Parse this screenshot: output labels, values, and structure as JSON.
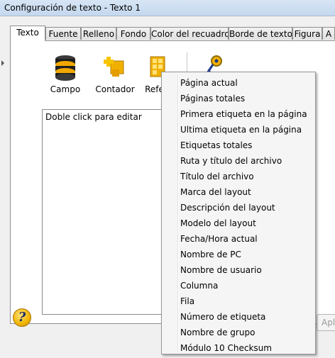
{
  "window": {
    "title": "Configuración de texto - Texto 1"
  },
  "tabs": [
    "Texto",
    "Fuente",
    "Relleno",
    "Fondo",
    "Color del recuadro",
    "Borde de texto",
    "Figura",
    "A"
  ],
  "toolbar": {
    "campo": "Campo",
    "contador": "Contador",
    "referencia": "Refer"
  },
  "editor": {
    "text": "Doble click para editar"
  },
  "apply_label": "Apli",
  "help_glyph": "?",
  "menu_items": [
    "Página actual",
    "Páginas totales",
    "Primera etiqueta en la página",
    "Ultima etiqueta en la página",
    "Etiquetas totales",
    "Ruta y título del archivo",
    "Título del archivo",
    "Marca del layout",
    "Descripción del layout",
    "Modelo del layout",
    "Fecha/Hora actual",
    "Nombre de PC",
    "Nombre de usuario",
    "Columna",
    "Fila",
    "Número de etiqueta",
    "Nombre de grupo",
    "Módulo 10 Checksum"
  ]
}
